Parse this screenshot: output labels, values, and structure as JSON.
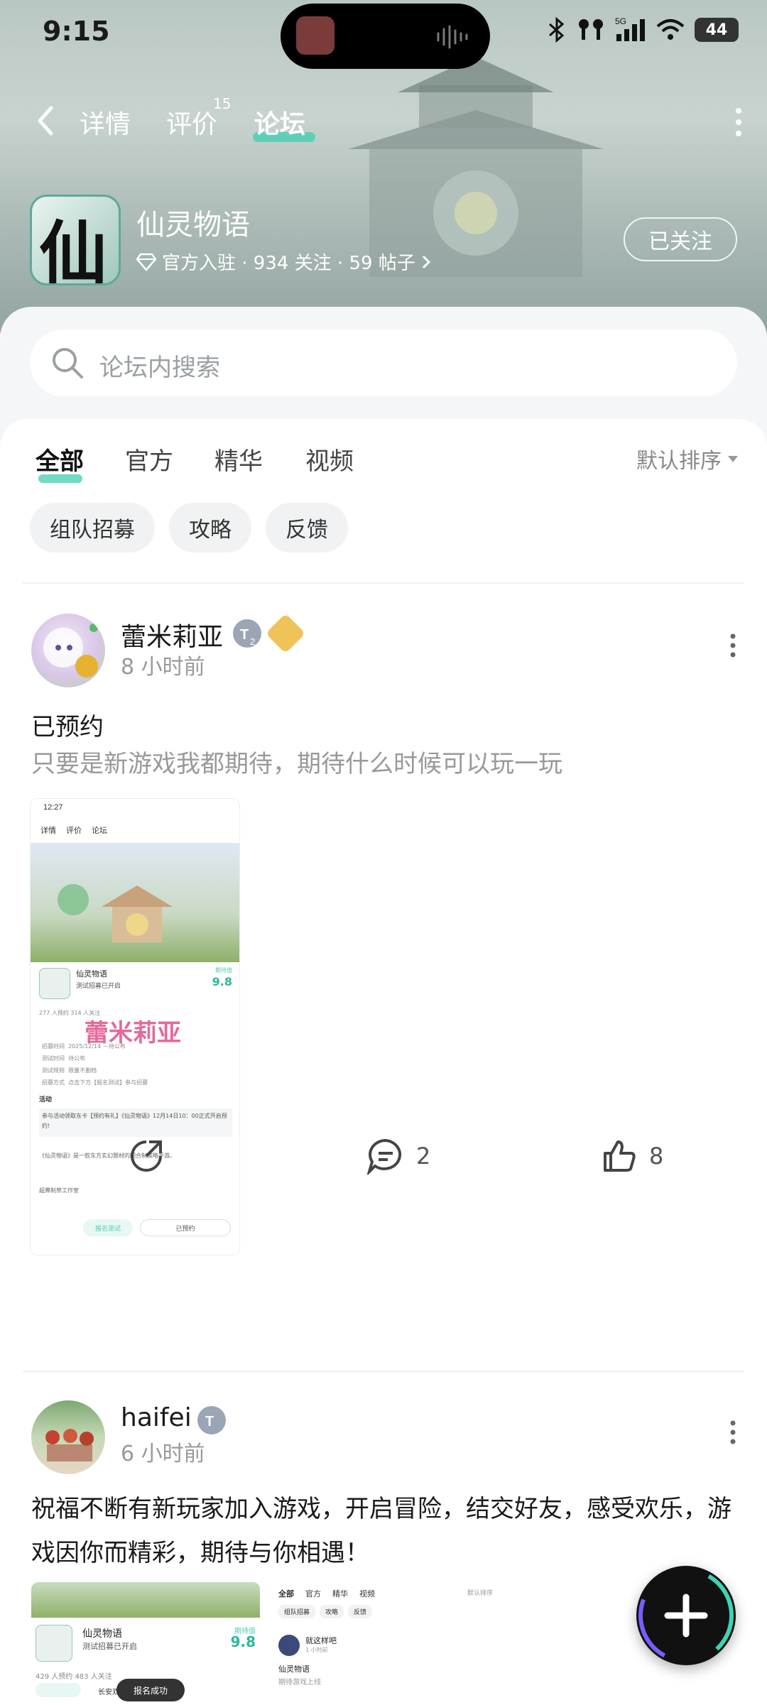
{
  "status_bar": {
    "time": "9:15",
    "battery": "44",
    "network": "5G"
  },
  "nav": {
    "tabs": [
      {
        "label": "详情"
      },
      {
        "label": "评价",
        "badge": "15"
      },
      {
        "label": "论坛"
      }
    ],
    "active_tab": "论坛"
  },
  "game": {
    "name": "仙灵物语",
    "icon_glyph": "仙",
    "meta": "官方入驻 · 934 关注 · 59 帖子",
    "follow_label": "已关注"
  },
  "search": {
    "placeholder": "论坛内搜索"
  },
  "filter_tabs": [
    "全部",
    "官方",
    "精华",
    "视频"
  ],
  "sort_label": "默认排序",
  "chips": [
    "组队招募",
    "攻略",
    "反馈"
  ],
  "posts": [
    {
      "author": "蕾米莉亚",
      "level_badge": "2",
      "time": "8 小时前",
      "title": "已预约",
      "body": "只要是新游戏我都期待，期待什么时候可以玩一玩",
      "screenshot": {
        "time": "12:27",
        "tabs": [
          "详情",
          "评价",
          "论坛"
        ],
        "game_name": "仙灵物语",
        "subtitle": "测试招募已开启",
        "score_label": "期待值",
        "score": "9.8",
        "stats": "277 人预约   314 人关注",
        "watermark": "蕾米莉亚",
        "rows": [
          "招募时间",
          "测试时间",
          "测试规则",
          "招募方式"
        ],
        "values": [
          "2025/12/14 —待公布",
          "待公布",
          "限量不删档",
          "点击下方【报名测试】参与招募"
        ],
        "event": "活动",
        "event_text": "参与活动领取东卡【预约有礼】《仙灵物语》12月14日10：00正式开启预约!",
        "desc": "《仙灵物语》是一款东方玄幻题材的回合制策略手游。",
        "dev": "超弗制草工作室",
        "btn_test": "报名测试",
        "btn_reserved": "已预约"
      },
      "share_count": "",
      "comment_count": "2",
      "like_count": "8"
    },
    {
      "author": "haifei",
      "time": "6 小时前",
      "body": "祝福不断有新玩家加入游戏，开启冒险，结交好友，感受欢乐，游戏因你而精彩，期待与你相遇！",
      "thumbs": {
        "left": {
          "game_name": "仙灵物语",
          "subtitle": "测试招募已开启",
          "score_label": "期待值",
          "score": "9.8",
          "stats": "429 人预约   483 人关注",
          "toast": "报名成功",
          "chip": "长安双球"
        },
        "right": {
          "tabs": [
            "全部",
            "官方",
            "精华",
            "视频"
          ],
          "sort": "默认排序",
          "chips": [
            "组队招募",
            "攻略",
            "反馈"
          ],
          "user": "就这样吧",
          "time": "1 小时前",
          "title": "仙灵物语",
          "body": "期待游戏上线"
        }
      }
    }
  ],
  "colors": {
    "accent": "#4ecfb7",
    "header": "#a9b8b4"
  }
}
